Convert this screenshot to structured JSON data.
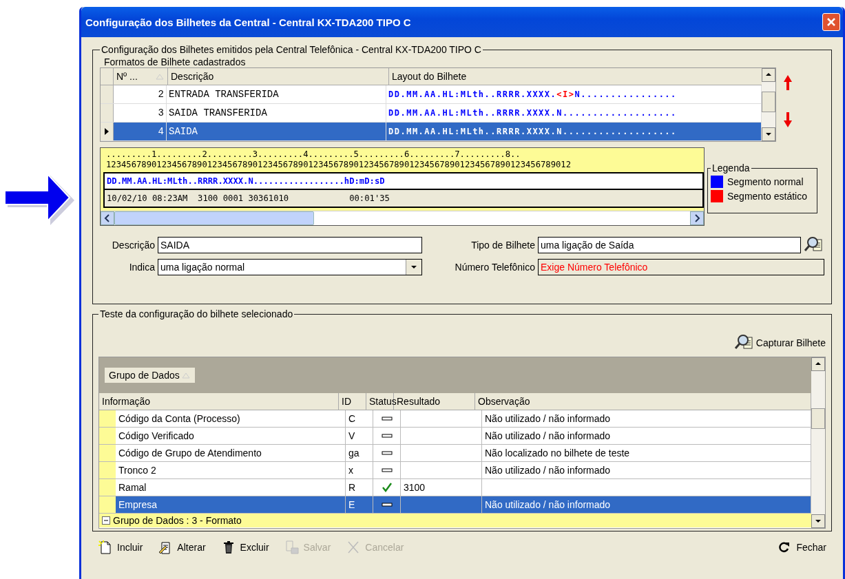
{
  "window": {
    "title": "Configuração dos Bilhetes da Central - Central KX-TDA200 TIPO C"
  },
  "config_group": {
    "title": "Configuração dos Bilhetes emitidos pela Central Telefônica - Central KX-TDA200 TIPO C",
    "formats_label": "Formatos de Bilhete cadastrados",
    "columns": [
      "Nº ...",
      "Descrição",
      "Layout do Bilhete"
    ],
    "rows": [
      {
        "number": "2",
        "description": "ENTRADA TRANSFERIDA",
        "selected": false,
        "layout": [
          {
            "text": "DD.MM.AA.HL:MLth..RRRR.XXXX.",
            "kind": "normal"
          },
          {
            "text": "<I>",
            "kind": "static"
          },
          {
            "text": "N................",
            "kind": "normal"
          }
        ]
      },
      {
        "number": "3",
        "description": "SAIDA TRANSFERIDA",
        "selected": false,
        "layout": [
          {
            "text": "DD.MM.AA.HL:MLth..RRRR.XXXX.N...................",
            "kind": "normal"
          }
        ]
      },
      {
        "number": "4",
        "description": "SAIDA",
        "selected": true,
        "layout": [
          {
            "text": "DD.MM.AA.HL:MLth..RRRR.XXXX.N...................",
            "kind": "normal"
          }
        ]
      }
    ],
    "ruler": [
      ".........1.........2.........3.........4.........5.........6.........7.........8..",
      "12345678901234567890123456789012345678901234567890123456789012345678901234567890123456789012"
    ],
    "layout_line": [
      {
        "text": "DD.MM.AA.HL:MLth..RRRR.XXXX.N..................hD:mD:sD",
        "kind": "normal"
      }
    ],
    "sample_line": "10/02/10 08:23AM  3100 0001 30361010            00:01'35",
    "legend": {
      "title": "Legenda",
      "items": [
        {
          "label": "Segmento normal",
          "color": "#0000ff"
        },
        {
          "label": "Segmento estático",
          "color": "#ff0000"
        }
      ]
    },
    "descricao": {
      "label": "Descrição",
      "value": "SAIDA"
    },
    "indica": {
      "label": "Indica",
      "value": "uma ligação normal"
    },
    "tipo": {
      "label": "Tipo de Bilhete",
      "value": "uma ligação de Saída"
    },
    "numero": {
      "label": "Número Telefônico",
      "value": "Exige Número Telefônico"
    }
  },
  "test_group": {
    "title": "Teste da configuração do bilhete selecionado",
    "capture_button": "Capturar Bilhete",
    "group_by": "Grupo de Dados",
    "columns": [
      "Informação",
      "ID",
      "Status",
      "Resultado",
      "Observação"
    ],
    "rows": [
      {
        "info": "Código da Conta (Processo)",
        "id": "C",
        "found": false,
        "result": "",
        "note": "Não utilizado / não informado",
        "selected": false
      },
      {
        "info": "Código Verificado",
        "id": "V",
        "found": false,
        "result": "",
        "note": "Não utilizado / não informado",
        "selected": false
      },
      {
        "info": "Código de Grupo de Atendimento",
        "id": "ga",
        "found": false,
        "result": "",
        "note": "Não localizado no bilhete de teste",
        "selected": false
      },
      {
        "info": "Tronco 2",
        "id": "x",
        "found": false,
        "result": "",
        "note": "Não utilizado / não informado",
        "selected": false
      },
      {
        "info": "Ramal",
        "id": "R",
        "found": true,
        "result": "3100",
        "note": "",
        "selected": false
      },
      {
        "info": "Empresa",
        "id": "E",
        "found": false,
        "result": "",
        "note": "Não utilizado / não informado",
        "selected": true
      }
    ],
    "group_row": "Grupo de Dados : 3 - Formato"
  },
  "toolbar": [
    {
      "label": "Incluir",
      "kind": "new",
      "disabled": false
    },
    {
      "label": "Alterar",
      "kind": "edit",
      "disabled": false
    },
    {
      "label": "Excluir",
      "kind": "delete",
      "disabled": false
    },
    {
      "label": "Salvar",
      "kind": "save",
      "disabled": true
    },
    {
      "label": "Cancelar",
      "kind": "cancel",
      "disabled": true
    },
    {
      "label": "Fechar",
      "kind": "close",
      "disabled": false
    }
  ]
}
